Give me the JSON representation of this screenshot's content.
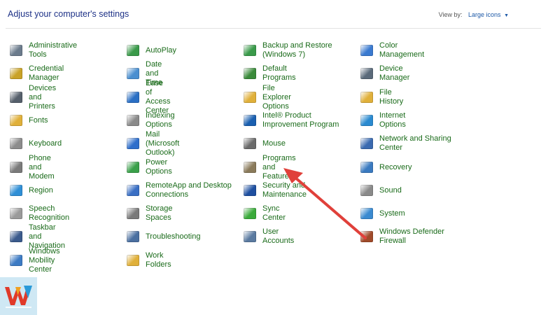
{
  "header": {
    "title": "Adjust your computer's settings",
    "view_by_label": "View by:",
    "view_by_value": "Large icons"
  },
  "columns": [
    {
      "items": [
        {
          "label": "Administrative Tools",
          "icon": "administrative-tools-icon",
          "color": "#6b7b8c"
        },
        {
          "label": "Credential Manager",
          "icon": "credential-manager-icon",
          "color": "#c9a227"
        },
        {
          "label": "Devices and Printers",
          "icon": "devices-printers-icon",
          "color": "#555f6b"
        },
        {
          "label": "Fonts",
          "icon": "fonts-icon",
          "color": "#e0b03a"
        },
        {
          "label": "Keyboard",
          "icon": "keyboard-icon",
          "color": "#8c8c8c"
        },
        {
          "label": "Phone and Modem",
          "icon": "phone-modem-icon",
          "color": "#7a7a7a"
        },
        {
          "label": "Region",
          "icon": "region-icon",
          "color": "#2f8fd6"
        },
        {
          "label": "Speech Recognition",
          "icon": "microphone-icon",
          "color": "#9a9a9a"
        },
        {
          "label": "Taskbar and Navigation",
          "icon": "taskbar-icon",
          "color": "#3a5a8c"
        },
        {
          "label": "Windows Mobility Center",
          "icon": "mobility-center-icon",
          "color": "#3d7bc4"
        }
      ]
    },
    {
      "items": [
        {
          "label": "AutoPlay",
          "icon": "autoplay-icon",
          "color": "#3a9a4a"
        },
        {
          "label": "Date and Time",
          "icon": "date-time-icon",
          "color": "#4a8fd0"
        },
        {
          "label": "Ease of Access Center",
          "icon": "ease-of-access-icon",
          "color": "#2a6fc4"
        },
        {
          "label": "Indexing Options",
          "icon": "indexing-options-icon",
          "color": "#8a8a8a"
        },
        {
          "label": "Mail (Microsoft Outlook)",
          "icon": "mail-outlook-icon",
          "color": "#2e6ecb"
        },
        {
          "label": "Power Options",
          "icon": "power-options-icon",
          "color": "#3aa04a"
        },
        {
          "label": "RemoteApp and Desktop Connections",
          "icon": "remoteapp-icon",
          "color": "#3a6fc4"
        },
        {
          "label": "Storage Spaces",
          "icon": "storage-spaces-icon",
          "color": "#7a7a7a"
        },
        {
          "label": "Troubleshooting",
          "icon": "troubleshooting-icon",
          "color": "#4a6fa0"
        },
        {
          "label": "Work Folders",
          "icon": "work-folders-icon",
          "color": "#e0b03a"
        }
      ]
    },
    {
      "items": [
        {
          "label": "Backup and Restore (Windows 7)",
          "icon": "backup-restore-icon",
          "color": "#3a9a4a"
        },
        {
          "label": "Default Programs",
          "icon": "default-programs-icon",
          "color": "#3a8a3a"
        },
        {
          "label": "File Explorer Options",
          "icon": "file-explorer-options-icon",
          "color": "#e0b03a"
        },
        {
          "label": "Intel® Product Improvement Program",
          "icon": "intel-icon",
          "color": "#1a5fb0"
        },
        {
          "label": "Mouse",
          "icon": "mouse-icon",
          "color": "#6a6a6a"
        },
        {
          "label": "Programs and Features",
          "icon": "programs-features-icon",
          "color": "#8a7a5a"
        },
        {
          "label": "Security and Maintenance",
          "icon": "security-maintenance-icon",
          "color": "#1e4fa0"
        },
        {
          "label": "Sync Center",
          "icon": "sync-center-icon",
          "color": "#3aaa3a"
        },
        {
          "label": "User Accounts",
          "icon": "user-accounts-icon",
          "color": "#5a7aa0"
        }
      ]
    },
    {
      "items": [
        {
          "label": "Color Management",
          "icon": "color-management-icon",
          "color": "#3a7ad0"
        },
        {
          "label": "Device Manager",
          "icon": "device-manager-icon",
          "color": "#5a6a7a"
        },
        {
          "label": "File History",
          "icon": "file-history-icon",
          "color": "#e0b03a"
        },
        {
          "label": "Internet Options",
          "icon": "internet-options-icon",
          "color": "#2a8ad0"
        },
        {
          "label": "Network and Sharing Center",
          "icon": "network-sharing-icon",
          "color": "#3a6ab0"
        },
        {
          "label": "Recovery",
          "icon": "recovery-icon",
          "color": "#3a7ac0"
        },
        {
          "label": "Sound",
          "icon": "sound-icon",
          "color": "#8a8a8a"
        },
        {
          "label": "System",
          "icon": "system-icon",
          "color": "#3a8ad0"
        },
        {
          "label": "Windows Defender Firewall",
          "icon": "firewall-icon",
          "color": "#a04a2a"
        }
      ]
    }
  ],
  "colors": {
    "title": "#1e3287",
    "link_green": "#1a6b1a",
    "arrow_red": "#e0403a",
    "watermark_bg": "#cfe8f4"
  }
}
